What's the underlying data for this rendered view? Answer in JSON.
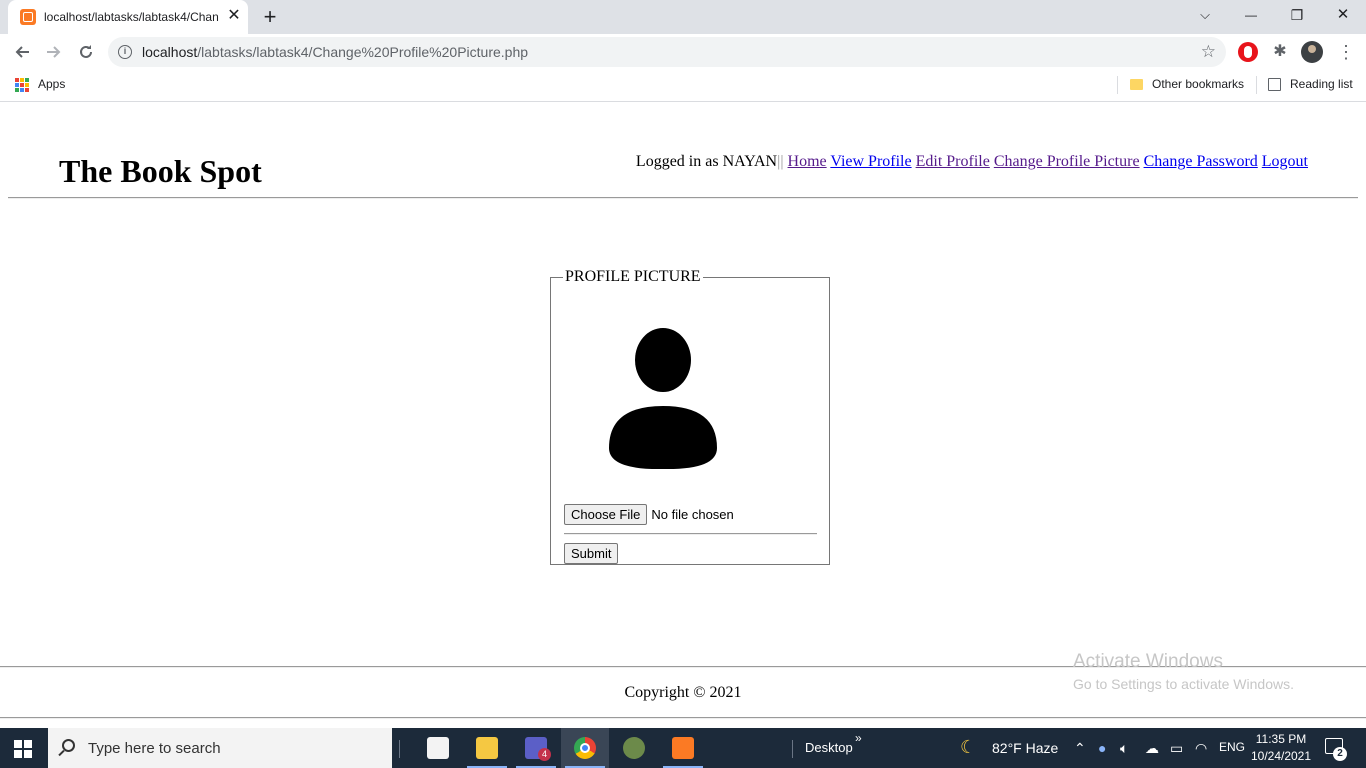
{
  "browser": {
    "tab_title": "localhost/labtasks/labtask4/Chan",
    "tab_close": "✕",
    "new_tab": "+",
    "window_controls": {
      "tabs_menu": "⌵",
      "minimize": "—",
      "restore": "❐",
      "close": "✕"
    },
    "url_host": "localhost",
    "url_path": "/labtasks/labtask4/Change%20Profile%20Picture.php",
    "bookmarks": {
      "apps": "Apps",
      "other": "Other bookmarks",
      "reading": "Reading list"
    }
  },
  "header": {
    "title": "The Book Spot",
    "logged_in_text": "Logged in as NAYAN",
    "separator": "||",
    "links": [
      "Home",
      "View Profile",
      "Edit Profile",
      "Change Profile Picture",
      "Change Password",
      "Logout"
    ]
  },
  "form": {
    "legend": "PROFILE PICTURE",
    "choose_file": "Choose File",
    "no_file": "No file chosen",
    "submit": "Submit"
  },
  "footer": {
    "copyright": "Copyright © 2021"
  },
  "watermark": {
    "line1": "Activate Windows",
    "line2": "Go to Settings to activate Windows."
  },
  "taskbar": {
    "search_placeholder": "Type here to search",
    "desktop_label": "Desktop",
    "more": "»",
    "weather": "82°F  Haze",
    "language": "ENG",
    "time": "11:35 PM",
    "date": "10/24/2021",
    "notification_count": "2",
    "teams_badge": "4"
  },
  "colors": {
    "link": "#0000ee",
    "link_visited": "#551a8b",
    "taskbar": "#1c2a3a",
    "xampp_orange": "#fb7a24"
  }
}
